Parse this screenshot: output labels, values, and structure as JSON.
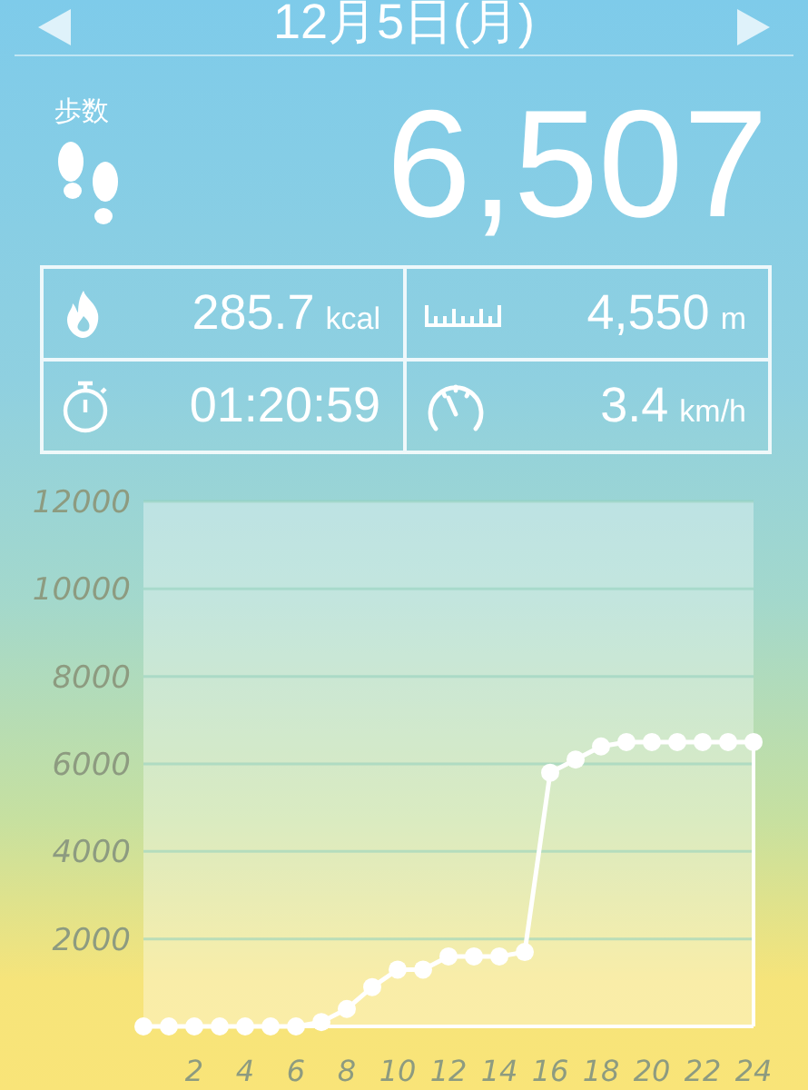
{
  "header": {
    "date": "12月5日(月)"
  },
  "steps": {
    "label": "歩数",
    "value": "6,507"
  },
  "stats": [
    {
      "kind": "calories",
      "value": "285.7",
      "unit": "kcal"
    },
    {
      "kind": "distance",
      "value": "4,550",
      "unit": "m"
    },
    {
      "kind": "time",
      "value": "01:20:59"
    },
    {
      "kind": "speed",
      "value": "3.4",
      "unit": "km/h"
    }
  ],
  "chart_data": {
    "type": "line",
    "x": [
      0,
      1,
      2,
      3,
      4,
      5,
      6,
      7,
      8,
      9,
      10,
      11,
      12,
      13,
      14,
      15,
      16,
      17,
      18,
      19,
      20,
      21,
      22,
      23,
      24
    ],
    "series": [
      {
        "color": "#ffffff",
        "marker": "circle",
        "values": [
          0,
          0,
          0,
          0,
          0,
          0,
          0,
          100,
          400,
          900,
          1300,
          1300,
          1600,
          1600,
          1600,
          1700,
          5800,
          6100,
          6400,
          6500,
          6500,
          6500,
          6500,
          6500,
          6500
        ]
      }
    ],
    "grid": true,
    "xlim": [
      0,
      24
    ],
    "ylim": [
      0,
      12000
    ],
    "xticks": [
      2,
      4,
      6,
      8,
      10,
      12,
      14,
      16,
      18,
      20,
      22,
      24
    ],
    "yticks": [
      2000,
      4000,
      6000,
      8000,
      10000,
      12000
    ]
  }
}
